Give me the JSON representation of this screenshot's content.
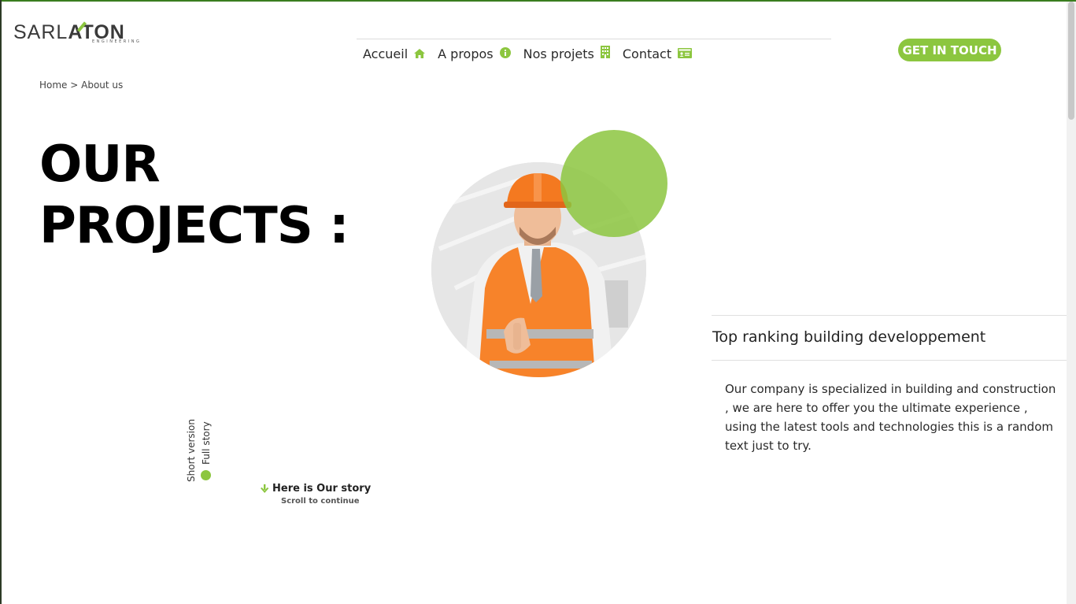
{
  "brand": {
    "logo_text_light": "SARL",
    "logo_text_bold": "ATON",
    "logo_subtext": "ENGINEERING",
    "accent_color": "#8cc63f"
  },
  "nav": {
    "items": [
      {
        "label": "Accueil",
        "icon": "home-icon"
      },
      {
        "label": "A propos",
        "icon": "info-icon"
      },
      {
        "label": "Nos projets",
        "icon": "building-icon"
      },
      {
        "label": "Contact",
        "icon": "id-card-icon"
      }
    ]
  },
  "cta": {
    "label": "GET IN TOUCH"
  },
  "breadcrumb": {
    "text": "Home > About us"
  },
  "hero": {
    "title_line1": "OUR",
    "title_line2": "PROJECTS :"
  },
  "tabs": {
    "short_label": "Short version",
    "full_label": "Full story"
  },
  "story": {
    "heading": "Here is Our story",
    "subtext": "Scroll to continue"
  },
  "panel": {
    "title": "Top ranking building developpement",
    "body": "Our company is specialized in building and construction , we are here to offer you the ultimate experience , using the latest tools and technologies this is a random text just to try."
  }
}
